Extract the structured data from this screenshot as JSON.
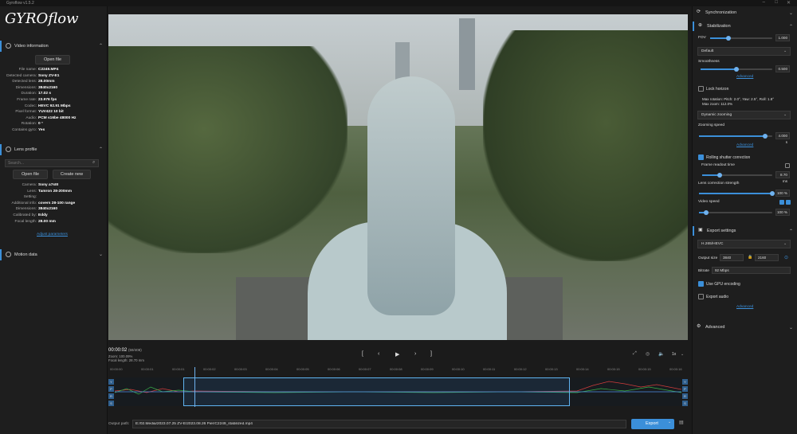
{
  "window": {
    "title": "Gyroflow v1.5.2"
  },
  "app": {
    "logo": "GYROflow"
  },
  "video_info": {
    "title": "Video information",
    "open_file": "Open file",
    "rows": [
      [
        "File name:",
        "C2249.MP4"
      ],
      [
        "Detected camera:",
        "Sony ZV-E1"
      ],
      [
        "Detected lens:",
        "28.00mm"
      ],
      [
        "Dimensions:",
        "3840x2160"
      ],
      [
        "Duration:",
        "17.02 s"
      ],
      [
        "Frame rate:",
        "23.976 fps"
      ],
      [
        "Codec:",
        "HEVC 92.91 Mbps"
      ],
      [
        "Pixel format:",
        "YUV422 10 bit"
      ],
      [
        "Audio:",
        "PCM s16be 48000 Hz"
      ],
      [
        "Rotation:",
        "0 °"
      ],
      [
        "Contains gyro:",
        "Yes"
      ]
    ]
  },
  "lens_profile": {
    "title": "Lens profile",
    "search_placeholder": "Search...",
    "open_file": "Open file",
    "create_new": "Create new",
    "rows": [
      [
        "Camera:",
        "Sony a7sIII"
      ],
      [
        "Lens:",
        "Tamron 28-200mm"
      ],
      [
        "Setting:",
        ""
      ],
      [
        "Additional info:",
        "covers 28-100 range"
      ],
      [
        "Dimensions:",
        "3840x2160"
      ],
      [
        "Calibrated by:",
        "Eddy"
      ],
      [
        "Focal length:",
        "28.00 mm"
      ]
    ],
    "adjust": "Adjust parameters"
  },
  "motion_data": {
    "title": "Motion data"
  },
  "sync": {
    "title": "Synchronization"
  },
  "stabilization": {
    "title": "Stabilization",
    "fov_label": "FOV",
    "fov_value": "1.000",
    "fov_level": 0.3,
    "preset": "Default",
    "smoothness_label": "Smoothness",
    "smoothness_value": "0.500",
    "smoothness_level": 0.5,
    "advanced": "Advanced",
    "lock_horizon": "Lock horizon",
    "max_rotation": "Max rotation: Pitch: 2.0°, Yaw: 2.5°, Roll: 1.8°",
    "max_zoom": "Max zoom: 112.0%",
    "zooming_method": "Dynamic zooming",
    "zooming_speed_label": "Zooming speed",
    "zooming_speed_value": "4.000 s",
    "zooming_speed_level": 0.9,
    "advanced2": "Advanced",
    "rolling_shutter": "Rolling shutter correction",
    "frame_readout": "Frame readout time",
    "frame_readout_value": "8.70 ms",
    "frame_readout_level": 0.25,
    "lens_strength_label": "Lens correction strength",
    "lens_strength_value": "100 %",
    "lens_strength_level": 1,
    "video_speed_label": "Video speed",
    "video_speed_value": "100 %",
    "video_speed_level": 0.1
  },
  "export": {
    "title": "Export settings",
    "codec": "H.265/HEVC",
    "output_size_label": "Output size",
    "width": "3840",
    "height": "2160",
    "bitrate_label": "Bitrate",
    "bitrate": "92 Mbps",
    "gpu_label": "Use GPU encoding",
    "audio_label": "Export audio",
    "advanced": "Advanced"
  },
  "advanced_section": {
    "title": "Advanced"
  },
  "player": {
    "time": "00:00:02",
    "frame": "(59/408)",
    "zoom": "Zoom: 100.09%",
    "focal": "Focal length: 28.70 mm",
    "speed": "1x"
  },
  "timeline": {
    "ticks": [
      "00:00:00",
      "00:00:01",
      "00:00:01",
      "00:00:02",
      "00:00:03",
      "00:00:04",
      "00:00:05",
      "00:00:06",
      "00:00:07",
      "00:00:08",
      "00:00:09",
      "00:00:10",
      "00:00:11",
      "00:00:12",
      "00:00:13",
      "00:00:14",
      "00:00:15",
      "00:00:15",
      "00:00:16"
    ],
    "side": [
      "Y",
      "P",
      "R",
      "S"
    ]
  },
  "output": {
    "label": "Output path:",
    "path": "E:/02.Media/2023.07.25 ZV-E/2023.08.26 Pier/C2249_stabilized.mp4",
    "export": "Export"
  }
}
